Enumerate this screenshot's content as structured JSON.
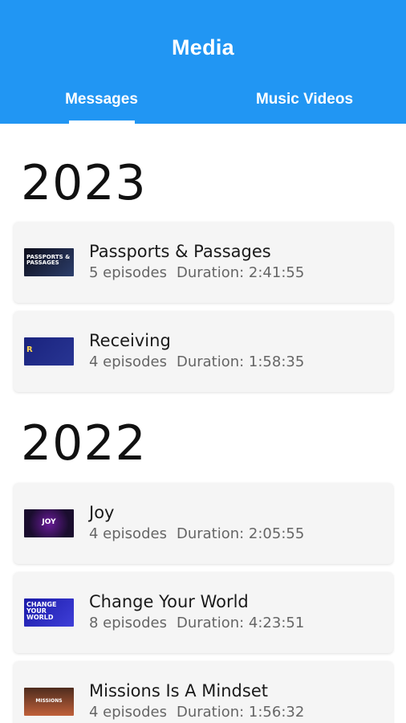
{
  "appbar": {
    "title": "Media",
    "background": "#2196f3",
    "tabs": [
      {
        "label": "Messages",
        "selected": true
      },
      {
        "label": "Music Videos",
        "selected": false
      }
    ]
  },
  "sections": [
    {
      "year": "2023",
      "items": [
        {
          "title": "Passports & Passages",
          "episodes": "5 episodes",
          "duration": "Duration: 2:41:55",
          "thumb_text": "PASSPORTS & PASSAGES",
          "thumb_colors": [
            "#0d0d1a",
            "#2c3e6b"
          ]
        },
        {
          "title": "Receiving",
          "episodes": "4 episodes",
          "duration": "Duration: 1:58:35",
          "thumb_text": "R",
          "thumb_colors": [
            "#1a237e",
            "#283593"
          ]
        }
      ]
    },
    {
      "year": "2022",
      "items": [
        {
          "title": "Joy",
          "episodes": "4 episodes",
          "duration": "Duration: 2:05:55",
          "thumb_text": "JOY",
          "thumb_colors": [
            "#1a0d2e",
            "#6a1b9a"
          ]
        },
        {
          "title": "Change Your World",
          "episodes": "8 episodes",
          "duration": "Duration: 4:23:51",
          "thumb_text": "CHANGE YOUR WORLD",
          "thumb_colors": [
            "#1a1aa8",
            "#3f3fd8"
          ]
        },
        {
          "title": "Missions Is A Mindset",
          "episodes": "4 episodes",
          "duration": "Duration: 1:56:32",
          "thumb_text": "MISSIONS",
          "thumb_colors": [
            "#4e2c1e",
            "#c0603a"
          ]
        }
      ]
    }
  ]
}
